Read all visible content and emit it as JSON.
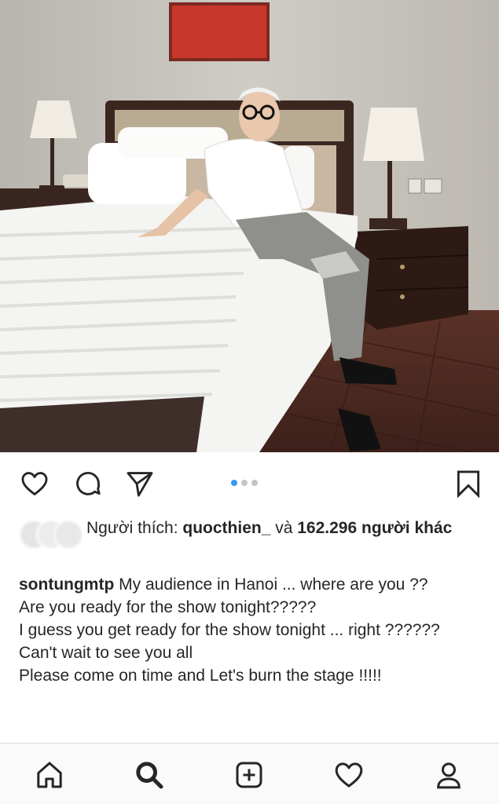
{
  "post": {
    "carousel": {
      "count": 3,
      "active_index": 0
    },
    "likes": {
      "prefix": "Người thích: ",
      "first_liker": "quocthien_",
      "connector": " và ",
      "others": "162.296 người khác"
    },
    "caption": {
      "username": "sontungmtp",
      "lines": [
        "My audience in Hanoi ... where are you ??",
        "Are you ready for the show tonight?????",
        "I guess you get ready for the show tonight ... right ??????",
        "Can't wait to see you all",
        "Please come on time and Let's burn the stage !!!!!"
      ]
    },
    "actions": [
      "heart-icon",
      "comment-icon",
      "share-icon",
      "bookmark-icon"
    ]
  },
  "bottom_nav": {
    "tabs": [
      "home-icon",
      "search-icon",
      "add-post-icon",
      "activity-icon",
      "profile-icon"
    ]
  },
  "colors": {
    "carousel_active": "#3897f0",
    "carousel_inactive": "#c4c4c4",
    "text": "#262626"
  }
}
